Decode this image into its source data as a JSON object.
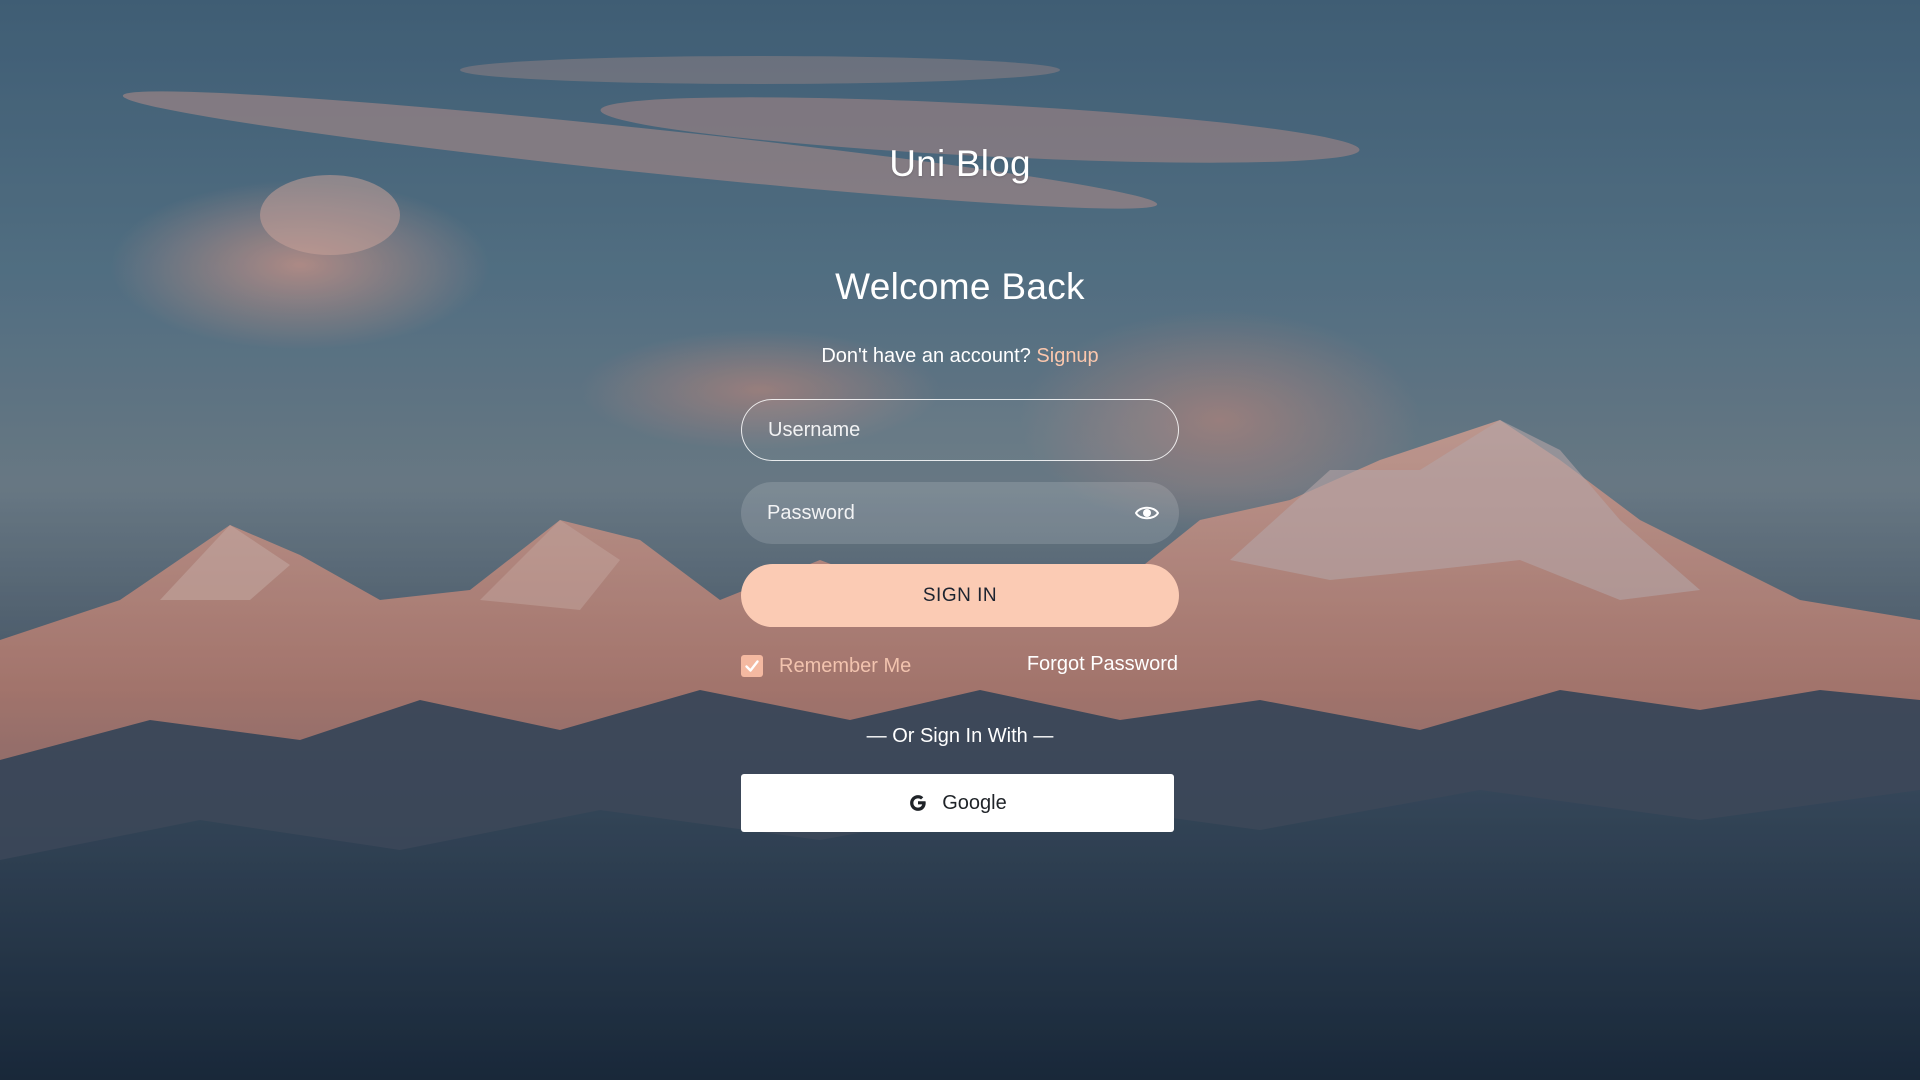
{
  "brand": {
    "title": "Uni Blog"
  },
  "form": {
    "heading": "Welcome Back",
    "signup_prompt": "Don't have an account?",
    "signup_link": "Signup",
    "username_placeholder": "Username",
    "password_placeholder": "Password",
    "signin_label": "SIGN IN",
    "remember_label": "Remember Me",
    "remember_checked": true,
    "forgot_label": "Forgot Password",
    "divider_label": "— Or Sign In With —",
    "google_label": "Google"
  },
  "icons": {
    "password_toggle": "eye-icon",
    "remember_check": "check-icon",
    "google": "google-g-icon"
  },
  "colors": {
    "accent": "#fbcbb4",
    "link": "#fbc7ad",
    "checkbox": "#f4b9a1",
    "button_text": "#1d2430"
  }
}
